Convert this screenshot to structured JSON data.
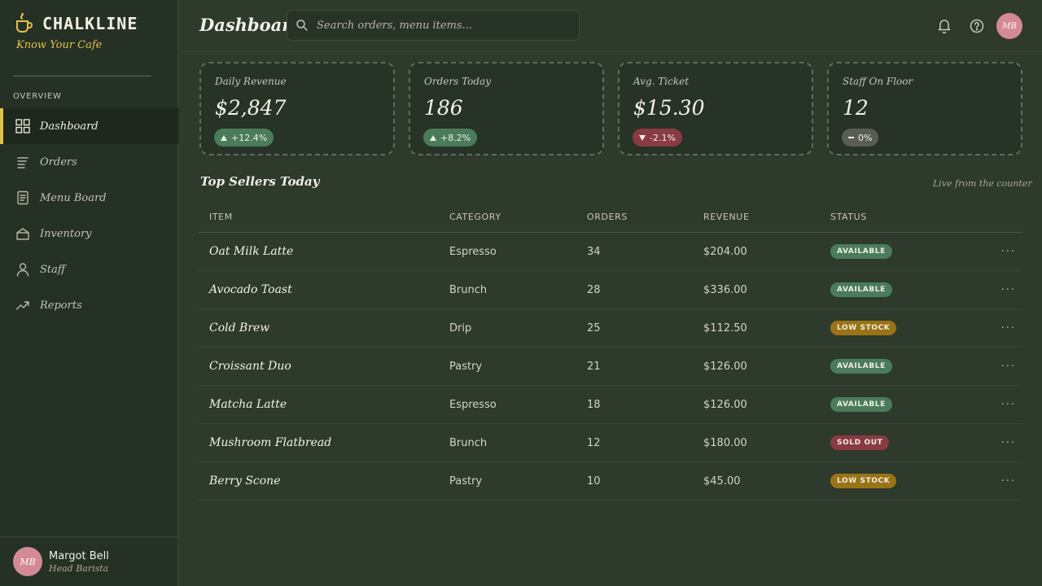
{
  "brand": {
    "name": "CHALKLINE",
    "tagline": "Know Your Cafe"
  },
  "sidebar": {
    "section_label": "OVERVIEW",
    "items": [
      {
        "label": "Dashboard",
        "icon": "grid-icon",
        "active": true
      },
      {
        "label": "Orders",
        "icon": "list-icon"
      },
      {
        "label": "Menu Board",
        "icon": "menu-board-icon"
      },
      {
        "label": "Inventory",
        "icon": "box-icon"
      },
      {
        "label": "Staff",
        "icon": "person-icon"
      },
      {
        "label": "Reports",
        "icon": "trend-icon"
      }
    ],
    "profile": {
      "initials": "MB",
      "name": "Margot Bell",
      "role": "Head Barista"
    }
  },
  "header": {
    "title": "Dashboard",
    "search_placeholder": "Search orders, menu items...",
    "avatar_initials": "MB"
  },
  "stats": [
    {
      "label": "Daily Revenue",
      "value": "$2,847",
      "delta": "+12.4%",
      "trend": "up"
    },
    {
      "label": "Orders Today",
      "value": "186",
      "delta": "+8.2%",
      "trend": "up"
    },
    {
      "label": "Avg. Ticket",
      "value": "$15.30",
      "delta": "-2.1%",
      "trend": "down"
    },
    {
      "label": "Staff On Floor",
      "value": "12",
      "delta": "0%",
      "trend": "flat"
    }
  ],
  "top_sellers": {
    "title": "Top Sellers Today",
    "note": "Live from the counter",
    "columns": [
      "ITEM",
      "CATEGORY",
      "ORDERS",
      "REVENUE",
      "STATUS"
    ],
    "rows": [
      {
        "item": "Oat Milk Latte",
        "category": "Espresso",
        "orders": "34",
        "revenue": "$204.00",
        "status": "AVAILABLE",
        "status_kind": "available"
      },
      {
        "item": "Avocado Toast",
        "category": "Brunch",
        "orders": "28",
        "revenue": "$336.00",
        "status": "AVAILABLE",
        "status_kind": "available"
      },
      {
        "item": "Cold Brew",
        "category": "Drip",
        "orders": "25",
        "revenue": "$112.50",
        "status": "LOW STOCK",
        "status_kind": "low"
      },
      {
        "item": "Croissant Duo",
        "category": "Pastry",
        "orders": "21",
        "revenue": "$126.00",
        "status": "AVAILABLE",
        "status_kind": "available"
      },
      {
        "item": "Matcha Latte",
        "category": "Espresso",
        "orders": "18",
        "revenue": "$126.00",
        "status": "AVAILABLE",
        "status_kind": "available"
      },
      {
        "item": "Mushroom Flatbread",
        "category": "Brunch",
        "orders": "12",
        "revenue": "$180.00",
        "status": "SOLD OUT",
        "status_kind": "sold"
      },
      {
        "item": "Berry Scone",
        "category": "Pastry",
        "orders": "10",
        "revenue": "$45.00",
        "status": "LOW STOCK",
        "status_kind": "low"
      }
    ],
    "row_action": "···"
  },
  "colors": {
    "accent": "#e1c24a",
    "background": "#2d3a2c",
    "available": "#4a7c5b",
    "low_stock": "#9a7316",
    "sold_out": "#8a3a41"
  }
}
